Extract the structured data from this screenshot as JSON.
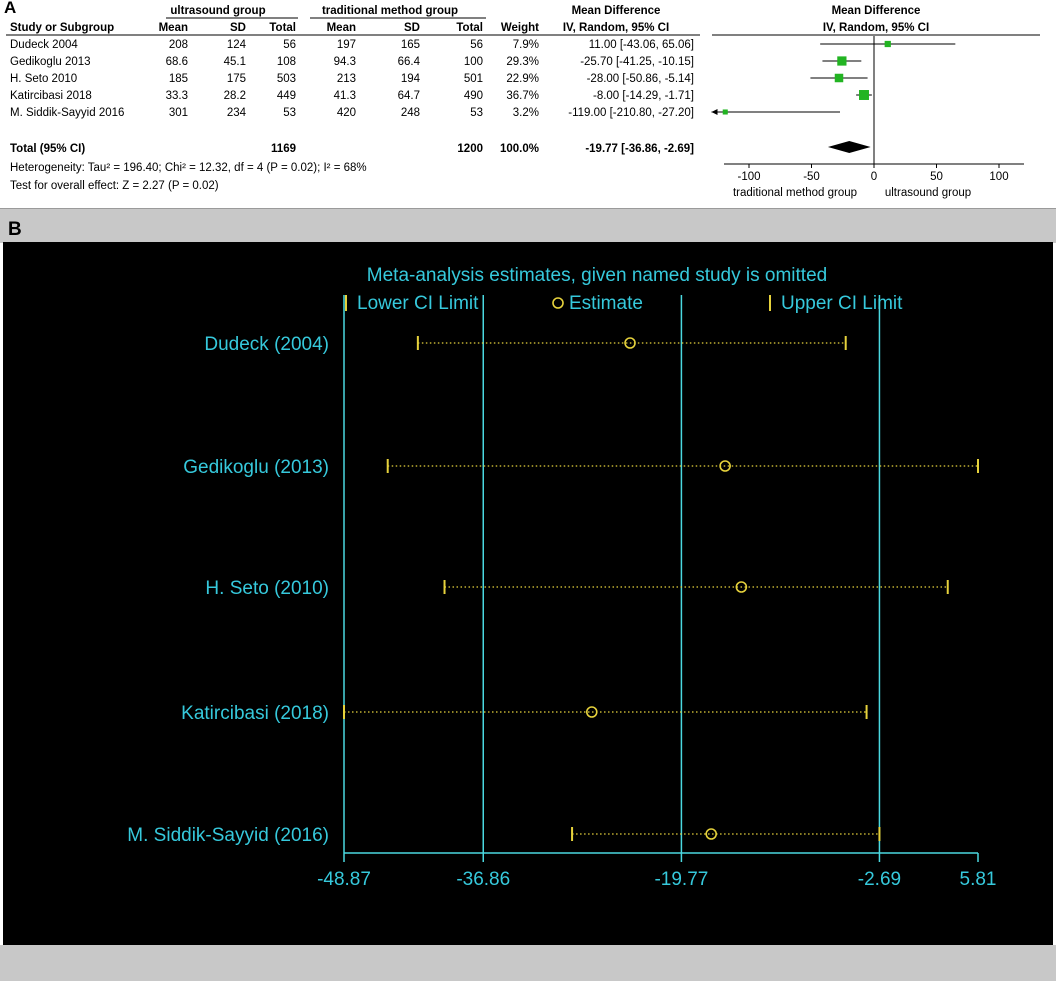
{
  "panel_a": {
    "letter": "A",
    "headers": {
      "group1": "ultrasound group",
      "group2": "traditional method group",
      "md_col": "Mean Difference",
      "md_method": "IV, Random, 95% CI",
      "plot_title": "Mean Difference",
      "plot_method": "IV, Random, 95% CI",
      "study": "Study or Subgroup",
      "mean1": "Mean",
      "sd1": "SD",
      "total1": "Total",
      "mean2": "Mean",
      "sd2": "SD",
      "total2": "Total",
      "weight": "Weight"
    },
    "rows": [
      {
        "study": "Dudeck 2004",
        "mean1": "208",
        "sd1": "124",
        "total1": "56",
        "mean2": "197",
        "sd2": "165",
        "total2": "56",
        "weight": "7.9%",
        "ci_text": "11.00 [-43.06, 65.06]"
      },
      {
        "study": "Gedikoglu 2013",
        "mean1": "68.6",
        "sd1": "45.1",
        "total1": "108",
        "mean2": "94.3",
        "sd2": "66.4",
        "total2": "100",
        "weight": "29.3%",
        "ci_text": "-25.70 [-41.25, -10.15]"
      },
      {
        "study": "H. Seto 2010",
        "mean1": "185",
        "sd1": "175",
        "total1": "503",
        "mean2": "213",
        "sd2": "194",
        "total2": "501",
        "weight": "22.9%",
        "ci_text": "-28.00 [-50.86, -5.14]"
      },
      {
        "study": "Katircibasi 2018",
        "mean1": "33.3",
        "sd1": "28.2",
        "total1": "449",
        "mean2": "41.3",
        "sd2": "64.7",
        "total2": "490",
        "weight": "36.7%",
        "ci_text": "-8.00 [-14.29, -1.71]"
      },
      {
        "study": "M. Siddik-Sayyid 2016",
        "mean1": "301",
        "sd1": "234",
        "total1": "53",
        "mean2": "420",
        "sd2": "248",
        "total2": "53",
        "weight": "3.2%",
        "ci_text": "-119.00 [-210.80, -27.20]"
      }
    ],
    "total": {
      "label": "Total (95% CI)",
      "total1": "1169",
      "total2": "1200",
      "weight": "100.0%",
      "ci_text": "-19.77 [-36.86, -2.69]"
    },
    "heterogeneity": "Heterogeneity: Tau² = 196.40; Chi² = 12.32, df = 4 (P = 0.02); I² = 68%",
    "overall_effect": "Test for overall effect: Z = 2.27 (P = 0.02)",
    "axis_left_label": "traditional method group",
    "axis_right_label": "ultrasound group"
  },
  "panel_b": {
    "letter": "B",
    "title": "Meta-analysis estimates, given named study is omitted",
    "legend": {
      "lower": "Lower CI Limit",
      "estimate": "Estimate",
      "upper": "Upper CI Limit"
    }
  },
  "colors": {
    "marker_green": "#22b422",
    "diamond": "#000000",
    "b_background": "#000000",
    "b_line": "#4ad8e0",
    "b_text": "#36c9dc",
    "b_ci": "#e6d23c"
  },
  "chart_data": [
    {
      "type": "forest",
      "title": "Mean Difference",
      "xlabel": "",
      "xlim": [
        -130,
        130
      ],
      "ticks": [
        -100,
        -50,
        0,
        50,
        100
      ],
      "studies": [
        {
          "name": "Dudeck 2004",
          "estimate": 11.0,
          "lower": -43.06,
          "upper": 65.06,
          "weight": 7.9
        },
        {
          "name": "Gedikoglu 2013",
          "estimate": -25.7,
          "lower": -41.25,
          "upper": -10.15,
          "weight": 29.3
        },
        {
          "name": "H. Seto 2010",
          "estimate": -28.0,
          "lower": -50.86,
          "upper": -5.14,
          "weight": 22.9
        },
        {
          "name": "Katircibasi 2018",
          "estimate": -8.0,
          "lower": -14.29,
          "upper": -1.71,
          "weight": 36.7
        },
        {
          "name": "M. Siddik-Sayyid 2016",
          "estimate": -119.0,
          "lower": -210.8,
          "upper": -27.2,
          "weight": 3.2
        }
      ],
      "pooled": {
        "estimate": -19.77,
        "lower": -36.86,
        "upper": -2.69
      }
    },
    {
      "type": "influence",
      "title": "Meta-analysis estimates, given named study is omitted",
      "xlim": [
        -48.87,
        5.81
      ],
      "ticks": [
        -48.87,
        -36.86,
        -19.77,
        -2.69,
        5.81
      ],
      "reference_lines": [
        -48.87,
        -36.86,
        -19.77,
        -2.69
      ],
      "studies": [
        {
          "name": "Dudeck (2004)",
          "lower": -42.5,
          "estimate": -24.2,
          "upper": -5.6
        },
        {
          "name": "Gedikoglu (2013)",
          "lower": -45.1,
          "estimate": -16.0,
          "upper": 5.81
        },
        {
          "name": "H. Seto (2010)",
          "lower": -40.2,
          "estimate": -14.6,
          "upper": 3.2
        },
        {
          "name": "Katircibasi (2018)",
          "lower": -48.87,
          "estimate": -27.5,
          "upper": -3.8
        },
        {
          "name": "M. Siddik-Sayyid (2016)",
          "lower": -29.2,
          "estimate": -17.2,
          "upper": -2.69
        }
      ]
    }
  ]
}
